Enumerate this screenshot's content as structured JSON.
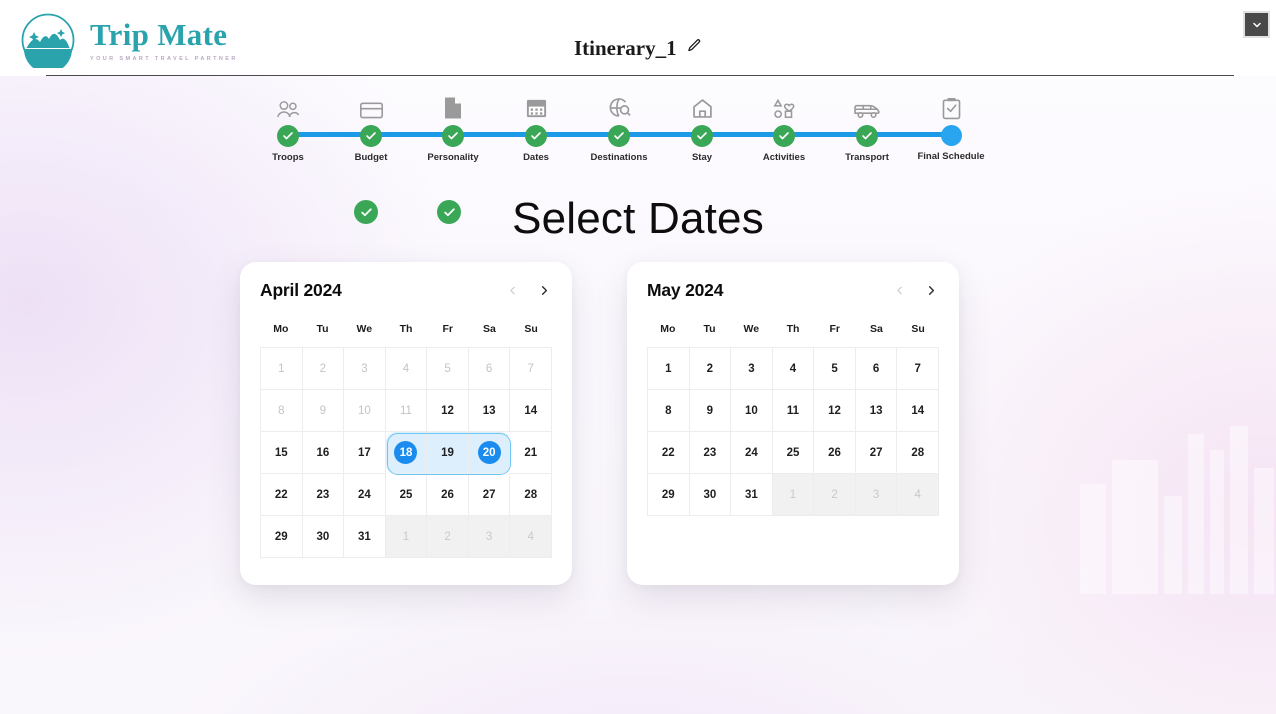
{
  "brand": {
    "title": "Trip Mate",
    "tagline": "YOUR SMART TRAVEL PARTNER",
    "logo_icon": "mountain-circle-logo",
    "accent_color": "#2aa3ad"
  },
  "header": {
    "document_title": "Itinerary_1",
    "edit_icon": "pencil-icon",
    "collapse_icon": "chevron-down-icon"
  },
  "stepper": {
    "line_color": "#1c9ae8",
    "done_color": "#3aa757",
    "active_color": "#29a5f0",
    "steps": [
      {
        "label": "Troops",
        "icon": "people-icon",
        "state": "done"
      },
      {
        "label": "Budget",
        "icon": "credit-card-icon",
        "state": "done"
      },
      {
        "label": "Personality",
        "icon": "document-icon",
        "state": "done"
      },
      {
        "label": "Dates",
        "icon": "calendar-icon",
        "state": "done"
      },
      {
        "label": "Destinations",
        "icon": "globe-search-icon",
        "state": "done"
      },
      {
        "label": "Stay",
        "icon": "home-icon",
        "state": "done"
      },
      {
        "label": "Activities",
        "icon": "shapes-icon",
        "state": "done"
      },
      {
        "label": "Transport",
        "icon": "van-icon",
        "state": "done"
      },
      {
        "label": "Final Schedule",
        "icon": "clipboard-check-icon",
        "state": "active"
      }
    ]
  },
  "main": {
    "page_title": "Select Dates",
    "badges": [
      {
        "icon": "check-circle-icon"
      },
      {
        "icon": "check-circle-icon"
      }
    ]
  },
  "calendars": {
    "weekdays": [
      "Mo",
      "Tu",
      "We",
      "Th",
      "Fr",
      "Sa",
      "Su"
    ],
    "prev_icon": "chevron-left-icon",
    "next_icon": "chevron-right-icon",
    "selection": {
      "start": "2024-04-18",
      "end": "2024-04-20",
      "selected_color": "#1a8cf0",
      "range_color": "#ddeffc"
    },
    "months": [
      {
        "title": "April 2024",
        "prev_enabled": false,
        "next_enabled": true,
        "weeks": [
          [
            {
              "day": 1,
              "state": "muted"
            },
            {
              "day": 2,
              "state": "muted"
            },
            {
              "day": 3,
              "state": "muted"
            },
            {
              "day": 4,
              "state": "muted"
            },
            {
              "day": 5,
              "state": "muted"
            },
            {
              "day": 6,
              "state": "muted"
            },
            {
              "day": 7,
              "state": "muted"
            }
          ],
          [
            {
              "day": 8,
              "state": "muted"
            },
            {
              "day": 9,
              "state": "muted"
            },
            {
              "day": 10,
              "state": "muted"
            },
            {
              "day": 11,
              "state": "muted"
            },
            {
              "day": 12,
              "state": "normal"
            },
            {
              "day": 13,
              "state": "normal"
            },
            {
              "day": 14,
              "state": "normal"
            }
          ],
          [
            {
              "day": 15,
              "state": "normal"
            },
            {
              "day": 16,
              "state": "normal"
            },
            {
              "day": 17,
              "state": "normal"
            },
            {
              "day": 18,
              "state": "selected-start"
            },
            {
              "day": 19,
              "state": "in-range"
            },
            {
              "day": 20,
              "state": "selected-end"
            },
            {
              "day": 21,
              "state": "normal"
            }
          ],
          [
            {
              "day": 22,
              "state": "normal"
            },
            {
              "day": 23,
              "state": "normal"
            },
            {
              "day": 24,
              "state": "normal"
            },
            {
              "day": 25,
              "state": "normal"
            },
            {
              "day": 26,
              "state": "normal"
            },
            {
              "day": 27,
              "state": "normal"
            },
            {
              "day": 28,
              "state": "normal"
            }
          ],
          [
            {
              "day": 29,
              "state": "normal"
            },
            {
              "day": 30,
              "state": "normal"
            },
            {
              "day": 31,
              "state": "normal"
            },
            {
              "day": 1,
              "state": "outside"
            },
            {
              "day": 2,
              "state": "outside"
            },
            {
              "day": 3,
              "state": "outside"
            },
            {
              "day": 4,
              "state": "outside"
            }
          ]
        ]
      },
      {
        "title": "May 2024",
        "prev_enabled": false,
        "next_enabled": true,
        "weeks": [
          [
            {
              "day": 1,
              "state": "normal"
            },
            {
              "day": 2,
              "state": "normal"
            },
            {
              "day": 3,
              "state": "normal"
            },
            {
              "day": 4,
              "state": "normal"
            },
            {
              "day": 5,
              "state": "normal"
            },
            {
              "day": 6,
              "state": "normal"
            },
            {
              "day": 7,
              "state": "normal"
            }
          ],
          [
            {
              "day": 8,
              "state": "normal"
            },
            {
              "day": 9,
              "state": "normal"
            },
            {
              "day": 10,
              "state": "normal"
            },
            {
              "day": 11,
              "state": "normal"
            },
            {
              "day": 12,
              "state": "normal"
            },
            {
              "day": 13,
              "state": "normal"
            },
            {
              "day": 14,
              "state": "normal"
            }
          ],
          [
            {
              "day": 22,
              "state": "normal"
            },
            {
              "day": 23,
              "state": "normal"
            },
            {
              "day": 24,
              "state": "normal"
            },
            {
              "day": 25,
              "state": "normal"
            },
            {
              "day": 26,
              "state": "normal"
            },
            {
              "day": 27,
              "state": "normal"
            },
            {
              "day": 28,
              "state": "normal"
            }
          ],
          [
            {
              "day": 29,
              "state": "normal"
            },
            {
              "day": 30,
              "state": "normal"
            },
            {
              "day": 31,
              "state": "normal"
            },
            {
              "day": 1,
              "state": "outside"
            },
            {
              "day": 2,
              "state": "outside"
            },
            {
              "day": 3,
              "state": "outside"
            },
            {
              "day": 4,
              "state": "outside"
            }
          ]
        ]
      }
    ]
  }
}
